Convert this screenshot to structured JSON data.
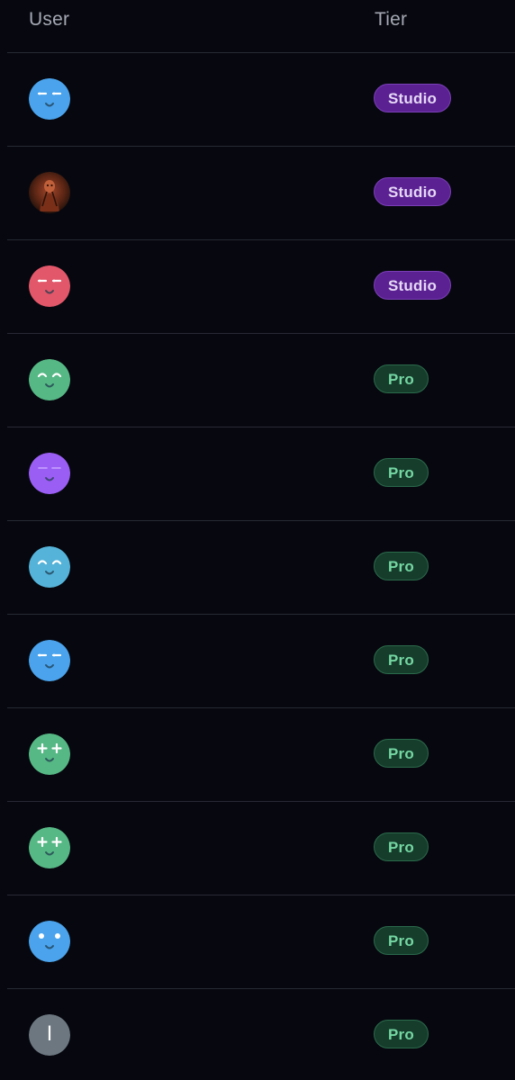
{
  "header": {
    "user_label": "User",
    "tier_label": "Tier"
  },
  "colors": {
    "background": "#07080f",
    "studio_badge": "#5b2193",
    "pro_badge": "#163d2c",
    "pro_text": "#74d7a2"
  },
  "rows": [
    {
      "avatar": {
        "type": "face",
        "color": "#4aa3ec",
        "eyes": "dash"
      },
      "tier": "Studio"
    },
    {
      "avatar": {
        "type": "photo"
      },
      "tier": "Studio"
    },
    {
      "avatar": {
        "type": "face",
        "color": "#e2576a",
        "eyes": "dash"
      },
      "tier": "Studio"
    },
    {
      "avatar": {
        "type": "face",
        "color": "#56b885",
        "eyes": "arc"
      },
      "tier": "Pro"
    },
    {
      "avatar": {
        "type": "face",
        "color": "#9b5ef5",
        "eyes": "flat"
      },
      "tier": "Pro"
    },
    {
      "avatar": {
        "type": "face",
        "color": "#55b3d9",
        "eyes": "arc"
      },
      "tier": "Pro"
    },
    {
      "avatar": {
        "type": "face",
        "color": "#4aa3ec",
        "eyes": "dash"
      },
      "tier": "Pro"
    },
    {
      "avatar": {
        "type": "face",
        "color": "#56b885",
        "eyes": "plus"
      },
      "tier": "Pro"
    },
    {
      "avatar": {
        "type": "face",
        "color": "#56b885",
        "eyes": "plus"
      },
      "tier": "Pro"
    },
    {
      "avatar": {
        "type": "face",
        "color": "#4aa3ec",
        "eyes": "dot"
      },
      "tier": "Pro"
    },
    {
      "avatar": {
        "type": "initial",
        "color": "#6c7780",
        "letter": "I"
      },
      "tier": "Pro"
    }
  ]
}
